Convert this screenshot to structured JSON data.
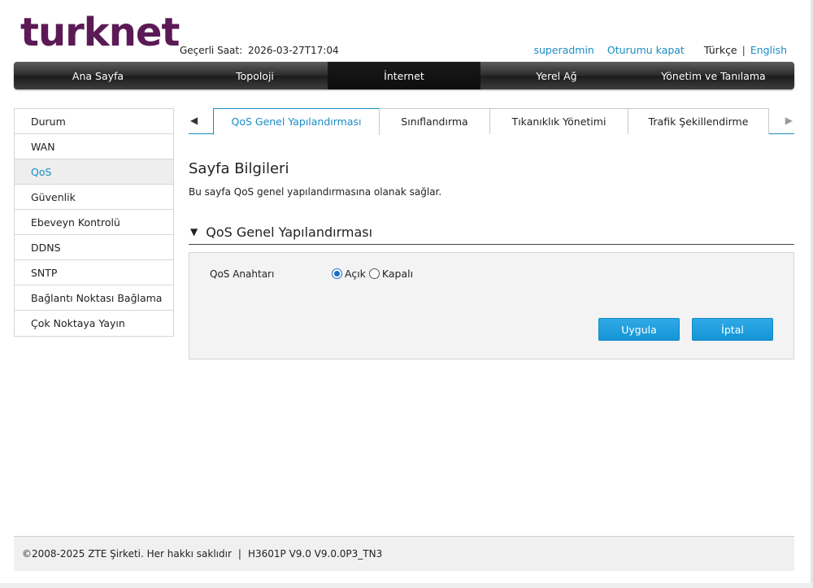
{
  "header": {
    "logo_text": "turknet",
    "clock_label": "Geçerli Saat:",
    "clock_value": "2026-03-27T17:04",
    "user_link": "superadmin",
    "logout_link": "Oturumu kapat",
    "lang_current": "Türkçe",
    "lang_separator": "|",
    "lang_other": "English"
  },
  "mainnav": {
    "tabs": [
      {
        "label": "Ana Sayfa"
      },
      {
        "label": "Topoloji"
      },
      {
        "label": "İnternet"
      },
      {
        "label": "Yerel Ağ"
      },
      {
        "label": "Yönetim ve Tanılama"
      }
    ],
    "active_index": 2
  },
  "sidebar": {
    "items": [
      {
        "label": "Durum"
      },
      {
        "label": "WAN"
      },
      {
        "label": "QoS"
      },
      {
        "label": "Güvenlik"
      },
      {
        "label": "Ebeveyn Kontrolü"
      },
      {
        "label": "DDNS"
      },
      {
        "label": "SNTP"
      },
      {
        "label": "Bağlantı Noktası Bağlama"
      },
      {
        "label": "Çok Noktaya Yayın"
      }
    ],
    "active_index": 2
  },
  "subtabs": {
    "left_arrow_icon": "triangle-left-icon",
    "right_arrow_icon": "triangle-right-icon",
    "tabs": [
      {
        "label": "QoS Genel Yapılandırması"
      },
      {
        "label": "Sınıflandırma"
      },
      {
        "label": "Tıkanıklık Yönetimi"
      },
      {
        "label": "Trafik Şekillendirme"
      }
    ],
    "active_index": 0
  },
  "page": {
    "title": "Sayfa Bilgileri",
    "description": "Bu sayfa QoS genel yapılandırmasına olanak sağlar."
  },
  "section": {
    "title": "QoS Genel Yapılandırması",
    "expanded": true,
    "collapse_icon": "triangle-down-icon"
  },
  "form": {
    "switch_label": "QoS Anahtarı",
    "option_on": "Açık",
    "option_off": "Kapalı",
    "selected": "on",
    "apply_label": "Uygula",
    "cancel_label": "İptal"
  },
  "footer": {
    "copyright": "©2008-2025 ZTE Şirketi. Her hakkı saklıdır",
    "separator": "|",
    "version": "H3601P V9.0 V9.0.0P3_TN3"
  },
  "colors": {
    "brand": "#5b1a55",
    "accent": "#1a8cc5",
    "button": "#1e9cdc"
  }
}
